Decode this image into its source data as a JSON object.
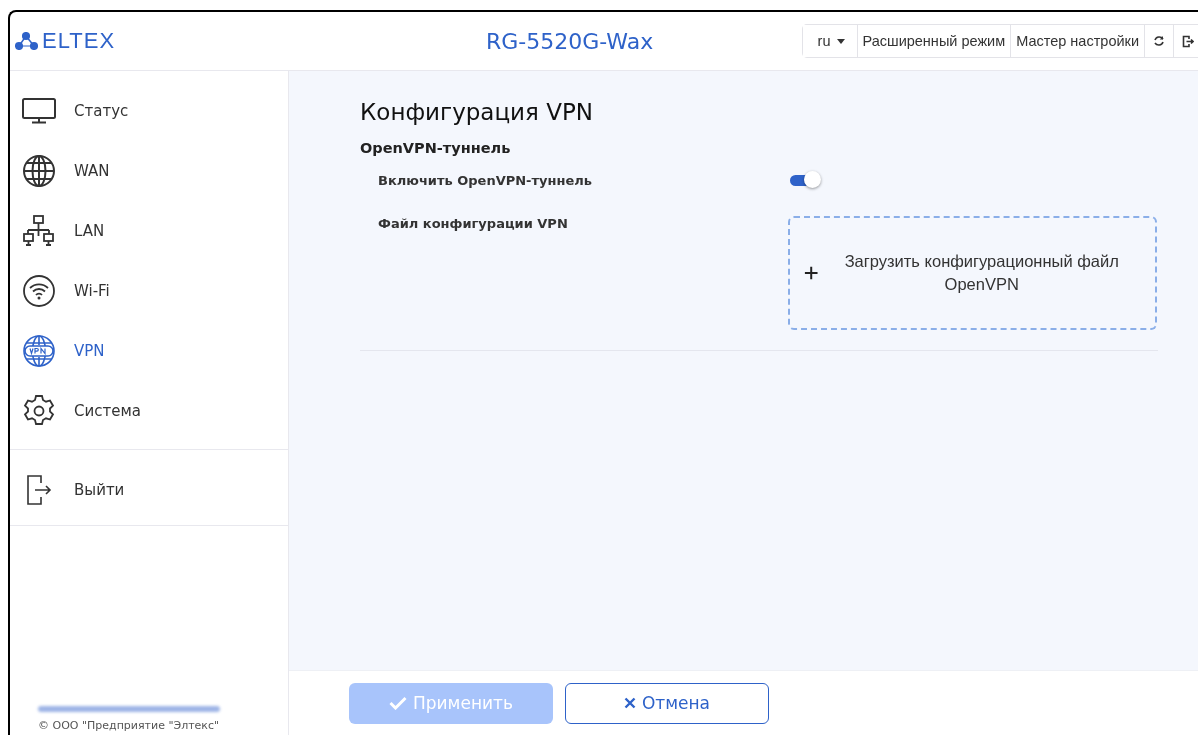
{
  "header": {
    "logo": "ELTEX",
    "model": "RG-5520G-Wax",
    "language": "ru",
    "links": [
      "Расширенный режим",
      "Мастер настройки"
    ]
  },
  "sidebar": {
    "items": [
      {
        "label": "Статус",
        "selected": false
      },
      {
        "label": "WAN",
        "selected": false
      },
      {
        "label": "LAN",
        "selected": false
      },
      {
        "label": "Wi-Fi",
        "selected": false
      },
      {
        "label": "VPN",
        "selected": true
      },
      {
        "label": "Система",
        "selected": false
      }
    ],
    "logout": "Выйти",
    "copyright": "© ООО \"Предприятие \"Элтекс\""
  },
  "page": {
    "title": "Конфигурация VPN",
    "section": "OpenVPN-туннель",
    "toggle": {
      "label": "Включить OpenVPN-туннель",
      "on": true
    },
    "file": {
      "label": "Файл конфигурации VPN",
      "upload": "Загрузить конфигурационный файл OpenVPN"
    }
  },
  "buttons": {
    "apply": {
      "label": "Применить",
      "disabled": true
    },
    "cancel": "Отмена"
  }
}
